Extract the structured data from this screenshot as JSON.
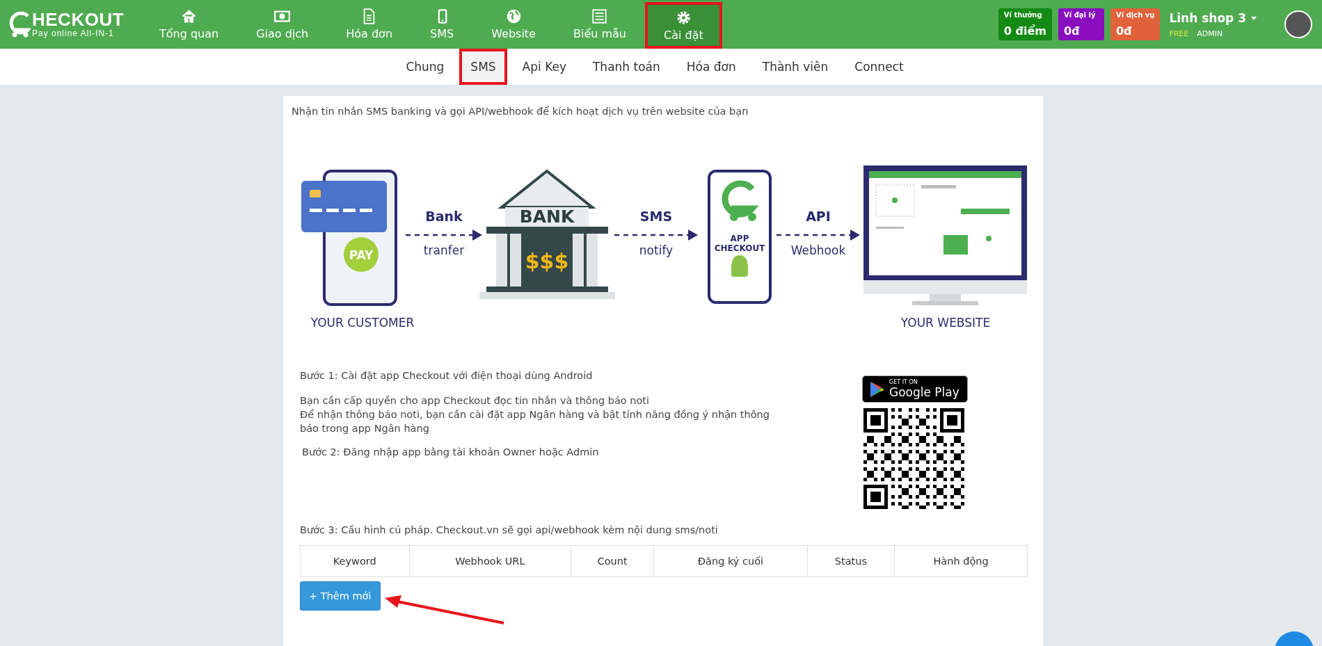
{
  "logo": {
    "title": "HECKOUT",
    "tagline": "Pay online All-IN-1"
  },
  "nav": [
    {
      "kind": "home",
      "label": "Tổng quan",
      "selected": false,
      "highlighted": false
    },
    {
      "kind": "money",
      "label": "Giao dịch",
      "selected": false,
      "highlighted": false
    },
    {
      "kind": "document",
      "label": "Hóa đơn",
      "selected": false,
      "highlighted": false
    },
    {
      "kind": "phone",
      "label": "SMS",
      "selected": false,
      "highlighted": false
    },
    {
      "kind": "globe",
      "label": "Website",
      "selected": false,
      "highlighted": false
    },
    {
      "kind": "form",
      "label": "Biểu mẫu",
      "selected": false,
      "highlighted": false
    },
    {
      "kind": "gear",
      "label": "Cài đặt",
      "selected": true,
      "highlighted": true
    }
  ],
  "wallets": [
    {
      "label": "Ví thưởng",
      "value": "0 điểm",
      "color": "#138a13"
    },
    {
      "label": "Ví đại lý",
      "value": "0đ",
      "color": "#8a0dbf"
    },
    {
      "label": "Ví dịch vụ",
      "value": "0đ",
      "color": "#e0623a"
    }
  ],
  "account": {
    "name": "Linh shop 3",
    "plan": "FREE",
    "role": "ADMIN"
  },
  "subtabs": [
    {
      "label": "Chung",
      "selected": false,
      "highlighted": false
    },
    {
      "label": "SMS",
      "selected": true,
      "highlighted": true
    },
    {
      "label": "Api Key",
      "selected": false,
      "highlighted": false
    },
    {
      "label": "Thanh toán",
      "selected": false,
      "highlighted": false
    },
    {
      "label": "Hóa đơn",
      "selected": false,
      "highlighted": false
    },
    {
      "label": "Thành viên",
      "selected": false,
      "highlighted": false
    },
    {
      "label": "Connect",
      "selected": false,
      "highlighted": false
    }
  ],
  "intro": "Nhận tin nhắn SMS banking và gọi API/webhook để kích hoạt dịch vụ trên website của bạn",
  "illustration": {
    "customer": {
      "badge": "PAY",
      "caption": "YOUR CUSTOMER"
    },
    "bank": {
      "sign": "BANK",
      "money": "$$$"
    },
    "app": {
      "name_line_1": "APP",
      "name_line_2": "CHECKOUT"
    },
    "website": {
      "caption": "YOUR WEBSITE"
    },
    "arrows": [
      {
        "top": "Bank",
        "bottom": "tranfer"
      },
      {
        "top": "SMS",
        "bottom": "notify"
      },
      {
        "top": "API",
        "bottom": "Webhook"
      }
    ]
  },
  "step_1": "Bước 1: Cài đặt app Checkout với điện thoại dùng Android",
  "permission_lines": [
    "Bạn cần cấp quyền cho app Checkout đọc tin nhắn và thông báo noti",
    "Để nhận thông báo noti, bạn cần cài đặt app Ngân hàng và bật tính năng đồng ý nhận thông báo trong app Ngân hàng"
  ],
  "step_2": "Bước 2: Đăng nhập app bằng tài khoản Owner hoặc Admin",
  "store_badge": {
    "small": "GET IT ON",
    "large": "Google Play"
  },
  "step_3": "Bước 3: Cấu hình cú pháp. Checkout.vn sẽ gọi api/webhook kèm nội dung sms/noti",
  "table": {
    "columns": [
      "Keyword",
      "Webhook URL",
      "Count",
      "Đăng ký cuối",
      "Status",
      "Hành động"
    ]
  },
  "add_button": "+ Thêm mới"
}
